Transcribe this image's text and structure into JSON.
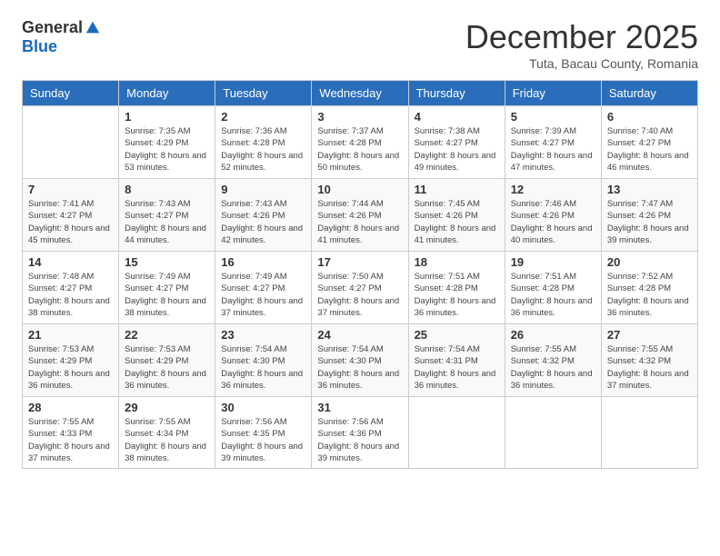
{
  "logo": {
    "general": "General",
    "blue": "Blue"
  },
  "header": {
    "month": "December 2025",
    "location": "Tuta, Bacau County, Romania"
  },
  "weekdays": [
    "Sunday",
    "Monday",
    "Tuesday",
    "Wednesday",
    "Thursday",
    "Friday",
    "Saturday"
  ],
  "weeks": [
    [
      {
        "day": "",
        "sunrise": "",
        "sunset": "",
        "daylight": ""
      },
      {
        "day": "1",
        "sunrise": "Sunrise: 7:35 AM",
        "sunset": "Sunset: 4:29 PM",
        "daylight": "Daylight: 8 hours and 53 minutes."
      },
      {
        "day": "2",
        "sunrise": "Sunrise: 7:36 AM",
        "sunset": "Sunset: 4:28 PM",
        "daylight": "Daylight: 8 hours and 52 minutes."
      },
      {
        "day": "3",
        "sunrise": "Sunrise: 7:37 AM",
        "sunset": "Sunset: 4:28 PM",
        "daylight": "Daylight: 8 hours and 50 minutes."
      },
      {
        "day": "4",
        "sunrise": "Sunrise: 7:38 AM",
        "sunset": "Sunset: 4:27 PM",
        "daylight": "Daylight: 8 hours and 49 minutes."
      },
      {
        "day": "5",
        "sunrise": "Sunrise: 7:39 AM",
        "sunset": "Sunset: 4:27 PM",
        "daylight": "Daylight: 8 hours and 47 minutes."
      },
      {
        "day": "6",
        "sunrise": "Sunrise: 7:40 AM",
        "sunset": "Sunset: 4:27 PM",
        "daylight": "Daylight: 8 hours and 46 minutes."
      }
    ],
    [
      {
        "day": "7",
        "sunrise": "Sunrise: 7:41 AM",
        "sunset": "Sunset: 4:27 PM",
        "daylight": "Daylight: 8 hours and 45 minutes."
      },
      {
        "day": "8",
        "sunrise": "Sunrise: 7:43 AM",
        "sunset": "Sunset: 4:27 PM",
        "daylight": "Daylight: 8 hours and 44 minutes."
      },
      {
        "day": "9",
        "sunrise": "Sunrise: 7:43 AM",
        "sunset": "Sunset: 4:26 PM",
        "daylight": "Daylight: 8 hours and 42 minutes."
      },
      {
        "day": "10",
        "sunrise": "Sunrise: 7:44 AM",
        "sunset": "Sunset: 4:26 PM",
        "daylight": "Daylight: 8 hours and 41 minutes."
      },
      {
        "day": "11",
        "sunrise": "Sunrise: 7:45 AM",
        "sunset": "Sunset: 4:26 PM",
        "daylight": "Daylight: 8 hours and 41 minutes."
      },
      {
        "day": "12",
        "sunrise": "Sunrise: 7:46 AM",
        "sunset": "Sunset: 4:26 PM",
        "daylight": "Daylight: 8 hours and 40 minutes."
      },
      {
        "day": "13",
        "sunrise": "Sunrise: 7:47 AM",
        "sunset": "Sunset: 4:26 PM",
        "daylight": "Daylight: 8 hours and 39 minutes."
      }
    ],
    [
      {
        "day": "14",
        "sunrise": "Sunrise: 7:48 AM",
        "sunset": "Sunset: 4:27 PM",
        "daylight": "Daylight: 8 hours and 38 minutes."
      },
      {
        "day": "15",
        "sunrise": "Sunrise: 7:49 AM",
        "sunset": "Sunset: 4:27 PM",
        "daylight": "Daylight: 8 hours and 38 minutes."
      },
      {
        "day": "16",
        "sunrise": "Sunrise: 7:49 AM",
        "sunset": "Sunset: 4:27 PM",
        "daylight": "Daylight: 8 hours and 37 minutes."
      },
      {
        "day": "17",
        "sunrise": "Sunrise: 7:50 AM",
        "sunset": "Sunset: 4:27 PM",
        "daylight": "Daylight: 8 hours and 37 minutes."
      },
      {
        "day": "18",
        "sunrise": "Sunrise: 7:51 AM",
        "sunset": "Sunset: 4:28 PM",
        "daylight": "Daylight: 8 hours and 36 minutes."
      },
      {
        "day": "19",
        "sunrise": "Sunrise: 7:51 AM",
        "sunset": "Sunset: 4:28 PM",
        "daylight": "Daylight: 8 hours and 36 minutes."
      },
      {
        "day": "20",
        "sunrise": "Sunrise: 7:52 AM",
        "sunset": "Sunset: 4:28 PM",
        "daylight": "Daylight: 8 hours and 36 minutes."
      }
    ],
    [
      {
        "day": "21",
        "sunrise": "Sunrise: 7:53 AM",
        "sunset": "Sunset: 4:29 PM",
        "daylight": "Daylight: 8 hours and 36 minutes."
      },
      {
        "day": "22",
        "sunrise": "Sunrise: 7:53 AM",
        "sunset": "Sunset: 4:29 PM",
        "daylight": "Daylight: 8 hours and 36 minutes."
      },
      {
        "day": "23",
        "sunrise": "Sunrise: 7:54 AM",
        "sunset": "Sunset: 4:30 PM",
        "daylight": "Daylight: 8 hours and 36 minutes."
      },
      {
        "day": "24",
        "sunrise": "Sunrise: 7:54 AM",
        "sunset": "Sunset: 4:30 PM",
        "daylight": "Daylight: 8 hours and 36 minutes."
      },
      {
        "day": "25",
        "sunrise": "Sunrise: 7:54 AM",
        "sunset": "Sunset: 4:31 PM",
        "daylight": "Daylight: 8 hours and 36 minutes."
      },
      {
        "day": "26",
        "sunrise": "Sunrise: 7:55 AM",
        "sunset": "Sunset: 4:32 PM",
        "daylight": "Daylight: 8 hours and 36 minutes."
      },
      {
        "day": "27",
        "sunrise": "Sunrise: 7:55 AM",
        "sunset": "Sunset: 4:32 PM",
        "daylight": "Daylight: 8 hours and 37 minutes."
      }
    ],
    [
      {
        "day": "28",
        "sunrise": "Sunrise: 7:55 AM",
        "sunset": "Sunset: 4:33 PM",
        "daylight": "Daylight: 8 hours and 37 minutes."
      },
      {
        "day": "29",
        "sunrise": "Sunrise: 7:55 AM",
        "sunset": "Sunset: 4:34 PM",
        "daylight": "Daylight: 8 hours and 38 minutes."
      },
      {
        "day": "30",
        "sunrise": "Sunrise: 7:56 AM",
        "sunset": "Sunset: 4:35 PM",
        "daylight": "Daylight: 8 hours and 39 minutes."
      },
      {
        "day": "31",
        "sunrise": "Sunrise: 7:56 AM",
        "sunset": "Sunset: 4:36 PM",
        "daylight": "Daylight: 8 hours and 39 minutes."
      },
      {
        "day": "",
        "sunrise": "",
        "sunset": "",
        "daylight": ""
      },
      {
        "day": "",
        "sunrise": "",
        "sunset": "",
        "daylight": ""
      },
      {
        "day": "",
        "sunrise": "",
        "sunset": "",
        "daylight": ""
      }
    ]
  ]
}
